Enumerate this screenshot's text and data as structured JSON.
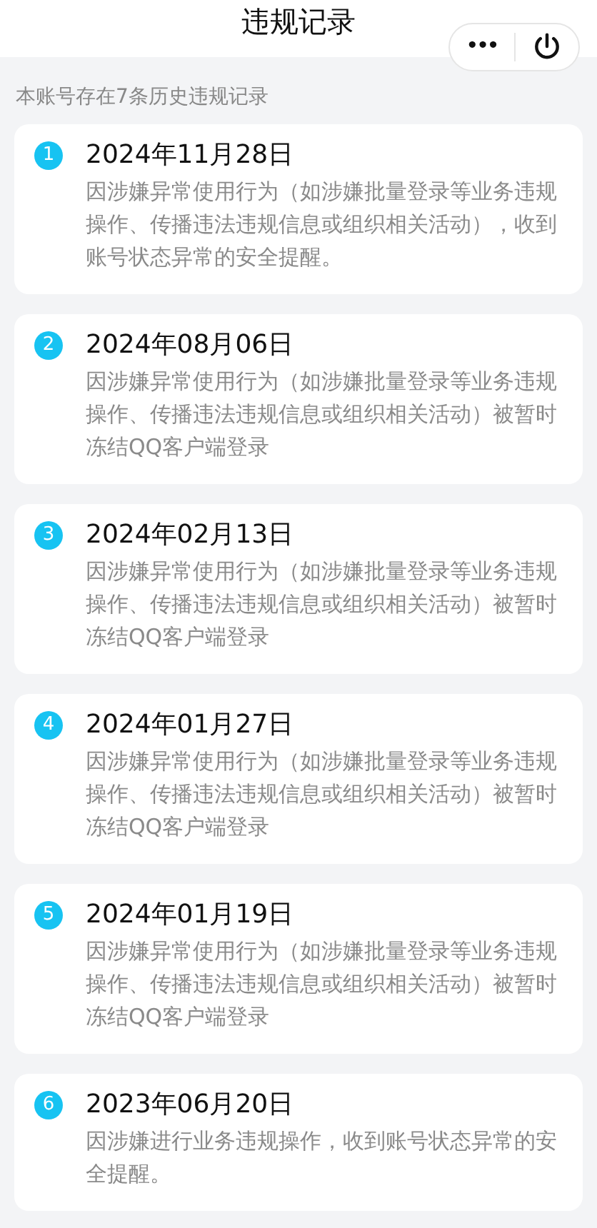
{
  "header": {
    "title": "违规记录",
    "more_button": "•••"
  },
  "summary": "本账号存在7条历史违规记录",
  "records": [
    {
      "index": "1",
      "date": "2024年11月28日",
      "description": "因涉嫌异常使用行为（如涉嫌批量登录等业务违规操作、传播违法违规信息或组织相关活动），收到账号状态异常的安全提醒。"
    },
    {
      "index": "2",
      "date": "2024年08月06日",
      "description": "因涉嫌异常使用行为（如涉嫌批量登录等业务违规操作、传播违法违规信息或组织相关活动）被暂时冻结QQ客户端登录"
    },
    {
      "index": "3",
      "date": "2024年02月13日",
      "description": "因涉嫌异常使用行为（如涉嫌批量登录等业务违规操作、传播违法违规信息或组织相关活动）被暂时冻结QQ客户端登录"
    },
    {
      "index": "4",
      "date": "2024年01月27日",
      "description": "因涉嫌异常使用行为（如涉嫌批量登录等业务违规操作、传播违法违规信息或组织相关活动）被暂时冻结QQ客户端登录"
    },
    {
      "index": "5",
      "date": "2024年01月19日",
      "description": "因涉嫌异常使用行为（如涉嫌批量登录等业务违规操作、传播违法违规信息或组织相关活动）被暂时冻结QQ客户端登录"
    },
    {
      "index": "6",
      "date": "2023年06月20日",
      "description": "因涉嫌进行业务违规操作，收到账号状态异常的安全提醒。"
    }
  ]
}
